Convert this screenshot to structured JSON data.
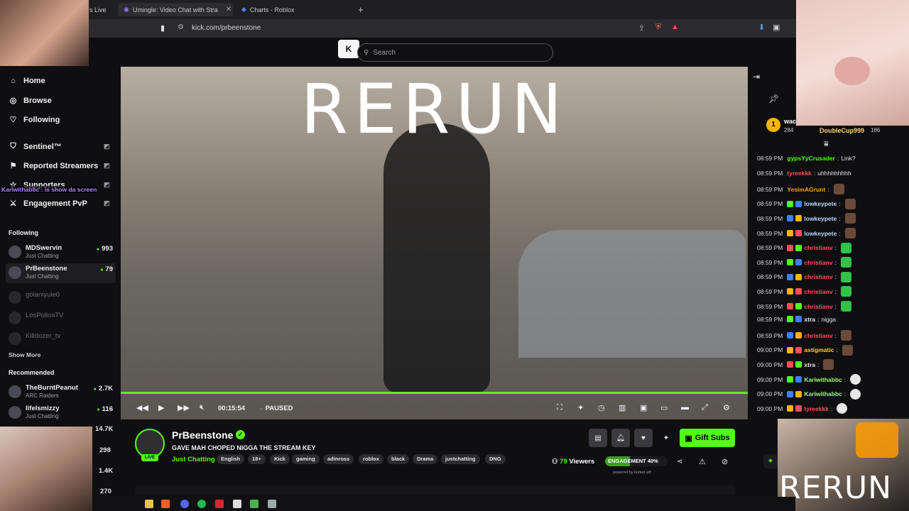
{
  "browser": {
    "tabs": [
      {
        "label": "s Live",
        "active": false
      },
      {
        "label": "Umingle: Video Chat with Stra",
        "active": true
      },
      {
        "label": "Charts - Roblox",
        "active": false
      }
    ],
    "url": "kick.com/prbeenstone"
  },
  "header": {
    "logo": "K",
    "search_placeholder": "Search"
  },
  "sidebar": {
    "nav": [
      {
        "label": "Home",
        "icon": "home-icon"
      },
      {
        "label": "Browse",
        "icon": "compass-icon"
      },
      {
        "label": "Following",
        "icon": "heart-icon"
      }
    ],
    "extensions": [
      {
        "label": "Sentinel™",
        "icon": "shield-icon"
      },
      {
        "label": "Reported Streamers",
        "icon": "flag-icon"
      },
      {
        "label": "Supporters",
        "icon": "star-icon"
      },
      {
        "label": "Engagement PvP",
        "icon": "swords-icon"
      }
    ],
    "overlay_text": "Kariwithabbc : is show da screen",
    "following_title": "Following",
    "following": [
      {
        "name": "MDSwervin",
        "sub": "Just Chatting",
        "count": "993",
        "live": true
      },
      {
        "name": "PrBeenstone",
        "sub": "Just Chatting",
        "count": "79",
        "live": true
      },
      {
        "name": "golaniyule0",
        "sub": "",
        "count": "",
        "live": false
      },
      {
        "name": "LosPollosTV",
        "sub": "",
        "count": "",
        "live": false
      },
      {
        "name": "Killdozer_tv",
        "sub": "",
        "count": "",
        "live": false
      }
    ],
    "show_more": "Show More",
    "recommended_title": "Recommended",
    "recommended": [
      {
        "name": "TheBurntPeanut",
        "sub": "ARC Raiders",
        "count": "2.7K"
      },
      {
        "name": "lifelsmizzy",
        "sub": "Just Chatting",
        "count": "116"
      }
    ],
    "partial_counts": [
      "14.7K",
      "298",
      "1.4K",
      "270"
    ]
  },
  "video": {
    "overlay_title": "RERUN",
    "time": "00:15:54",
    "state": "PAUSED",
    "progress": 1.0
  },
  "stream": {
    "streamer": "PrBeenstone",
    "live_label": "LIVE",
    "title": "GAVE MAH CHOPED NIGGA THE STREAM KEY",
    "category": "Just Chatting",
    "tags": [
      "English",
      "18+",
      "Kick",
      "gaming",
      "adinross",
      "roblox",
      "black",
      "Drama",
      "justchatting",
      "DNG"
    ],
    "viewers_count": "79",
    "viewers_label": "Viewers",
    "engagement_label": "ENGAGEMENT 40%",
    "engagement": 0.4,
    "powered_by": "powered by botted.wtf",
    "gift_label": "Gift Subs"
  },
  "chat": {
    "leaderboard": {
      "rank": "1",
      "name_partial": "wac",
      "points_partial": "284",
      "second_name": "DoubleCup999",
      "second_points": "186"
    },
    "messages": [
      {
        "time": "08:59 PM",
        "user": "gypsYyCrusader",
        "color": "#53fc18",
        "text": "Link?",
        "emote": ""
      },
      {
        "time": "08:59 PM",
        "user": "tyreekkk",
        "color": "#ff4d5e",
        "text": "uhhhhhhhhh",
        "emote": ""
      },
      {
        "time": "08:59 PM",
        "user": "YesimAGrunt",
        "color": "#ff9b1a",
        "text": "",
        "emote": "brown"
      },
      {
        "time": "08:59 PM",
        "user": "lowkeypete",
        "color": "#b6d8ff",
        "text": "",
        "emote": "brown"
      },
      {
        "time": "08:59 PM",
        "user": "lowkeypete",
        "color": "#b6d8ff",
        "text": "",
        "emote": "brown"
      },
      {
        "time": "08:59 PM",
        "user": "lowkeypete",
        "color": "#b6d8ff",
        "text": "",
        "emote": "brown"
      },
      {
        "time": "08:59 PM",
        "user": "christianv",
        "color": "#ff4d5e",
        "text": "",
        "emote": "green"
      },
      {
        "time": "08:59 PM",
        "user": "christianv",
        "color": "#ff4d5e",
        "text": "",
        "emote": "green"
      },
      {
        "time": "08:59 PM",
        "user": "christianv",
        "color": "#ff4d5e",
        "text": "",
        "emote": "green"
      },
      {
        "time": "08:59 PM",
        "user": "christianv",
        "color": "#ff4d5e",
        "text": "",
        "emote": "green"
      },
      {
        "time": "08:59 PM",
        "user": "christianv",
        "color": "#ff4d5e",
        "text": "",
        "emote": "green"
      },
      {
        "time": "08:59 PM",
        "user": "xtra",
        "color": "#e8e8ea",
        "text": "nigga",
        "emote": ""
      },
      {
        "time": "08:59 PM",
        "user": "christianv",
        "color": "#ff4d5e",
        "text": "",
        "emote": "brown"
      },
      {
        "time": "09:00 PM",
        "user": "astigmatic",
        "color": "#ffd21a",
        "text": "",
        "emote": "brown"
      },
      {
        "time": "09:00 PM",
        "user": "xtra",
        "color": "#e8e8ea",
        "text": "",
        "emote": "brown"
      },
      {
        "time": "09:00 PM",
        "user": "Kariwithabbc",
        "color": "#9dff6a",
        "text": "",
        "emote": "white"
      },
      {
        "time": "09:00 PM",
        "user": "Kariwithabbc",
        "color": "#9dff6a",
        "text": "",
        "emote": "white"
      },
      {
        "time": "09:00 PM",
        "user": "tyreekkk",
        "color": "#ff4d5e",
        "text": "",
        "emote": "white"
      }
    ]
  },
  "webcam": {
    "overlay": "RERUN"
  },
  "colors": {
    "accent": "#53fc18",
    "background": "#0f0f11"
  }
}
